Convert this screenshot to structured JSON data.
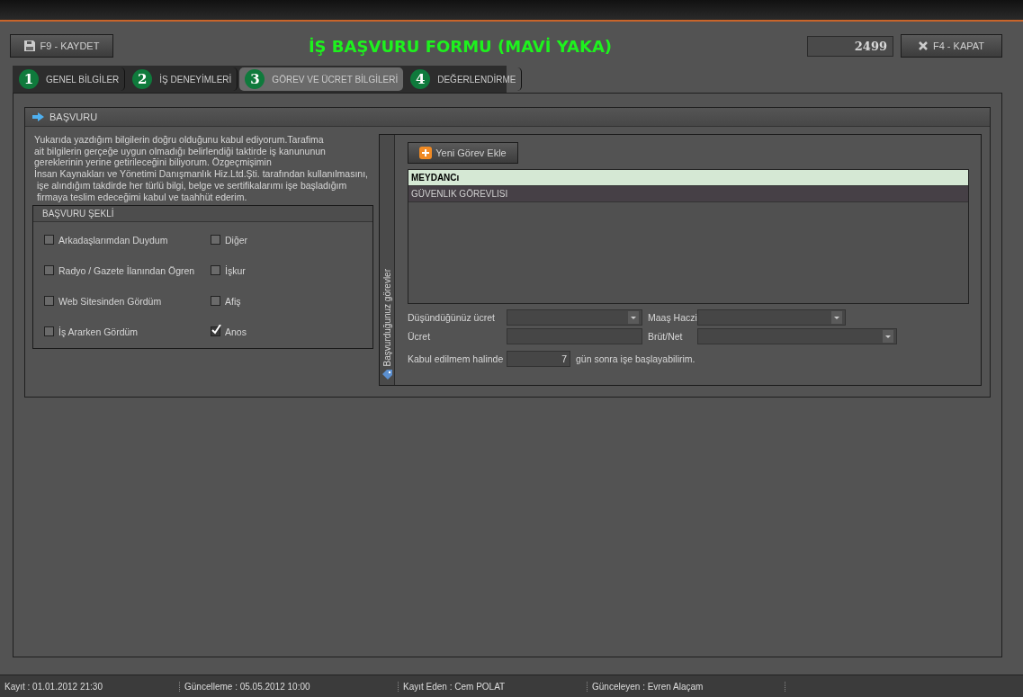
{
  "header": {
    "save_button": "F9 - KAYDET",
    "title": "İŞ BAŞVURU FORMU (MAVİ YAKA)",
    "record_no": "2499",
    "close_button": "F4 - KAPAT"
  },
  "tabs": [
    {
      "number": "1",
      "label": "GENEL BİLGİLER",
      "selected": false
    },
    {
      "number": "2",
      "label": "İŞ DENEYİMLERİ",
      "selected": false
    },
    {
      "number": "3",
      "label": "GÖREV VE ÜCRET BİLGİLERİ",
      "selected": true
    },
    {
      "number": "4",
      "label": "DEĞERLENDİRME",
      "selected": false
    }
  ],
  "section": {
    "title": "BAŞVURU",
    "statement": "Yukarıda yazdığım bilgilerin doğru olduğunu kabul ediyorum.Tarafima\nait bilgilerin gerçeğe uygun olmadığı belirlendiği taktirde iş kanununun\ngereklerinin yerine getirileceğini biliyorum. Özgeçmişimin\nİnsan Kaynakları ve Yönetimi Danışmanlık Hiz.Ltd.Şti. tarafından kullanılmasını,\n işe alındığım takdirde her türlü bilgi, belge ve sertifikalarımı işe başladığım\n firmaya teslim edeceğimi kabul ve taahhüt ederim.",
    "application_type": {
      "title": "BAŞVURU ŞEKLİ",
      "options": [
        {
          "label": "Arkadaşlarımdan Duydum",
          "checked": false
        },
        {
          "label": "Diğer",
          "checked": false
        },
        {
          "label": "Radyo / Gazete İlanından Ögren",
          "checked": false
        },
        {
          "label": "İşkur",
          "checked": false
        },
        {
          "label": "Web Sitesinden Gördüm",
          "checked": false
        },
        {
          "label": "Afiş",
          "checked": false
        },
        {
          "label": "İş Ararken Gördüm",
          "checked": false
        },
        {
          "label": "Anos",
          "checked": true
        }
      ]
    },
    "positions": {
      "side_label": "Başvurduğunuz görevler",
      "add_button": "Yeni Görev Ekle",
      "items": [
        {
          "label": "MEYDANCı",
          "selected": true
        },
        {
          "label": "GÜVENLIK GÖREVLISI",
          "selected": false
        }
      ],
      "expected_salary_label": "Düşündüğünüz ücret",
      "garnishment_label": "Maaş Haczi",
      "salary_label": "Ücret",
      "gross_net_label": "Brüt/Net",
      "start_label": "Kabul edilmem halinde",
      "start_days": "7",
      "start_suffix": "gün sonra işe başlayabilirim."
    }
  },
  "status_bar": [
    "Kayıt : 01.01.2012 21:30",
    "Güncelleme : 05.05.2012 10:00",
    "Kayıt Eden : Cem POLAT",
    "Günceleyen : Evren Alaçam"
  ]
}
